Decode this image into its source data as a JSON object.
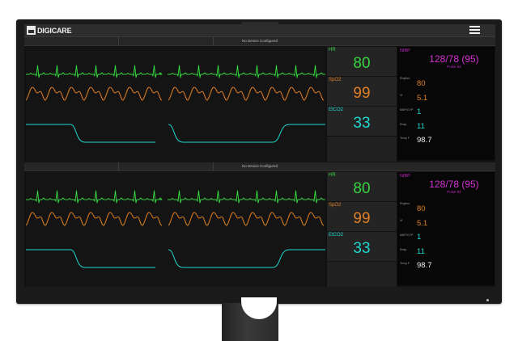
{
  "app": {
    "logo_text": "DIGICARE"
  },
  "colors": {
    "hr": "#36d43f",
    "spo2": "#e07f25",
    "etco2": "#1fd9d0",
    "nibp": "#d632d6",
    "temp": "#eeeeee"
  },
  "panels": [
    {
      "status": "No Device Configured",
      "hr": {
        "label": "HR",
        "value": "80"
      },
      "spo2": {
        "label": "SpO2",
        "value": "99"
      },
      "etco2": {
        "label": "EtCO2",
        "value": "33"
      },
      "nibp": {
        "label": "NIBP",
        "value": "128/78 (95)",
        "pulse": "Pulse 82"
      },
      "params": [
        {
          "label": "Rhythm",
          "value": "80"
        },
        {
          "label": "Vt",
          "value": "5.1"
        },
        {
          "label": "MAP/CVP",
          "value": "1"
        },
        {
          "label": "Resp",
          "value": "11"
        },
        {
          "label": "Temp F",
          "value": "98.7"
        }
      ]
    },
    {
      "status": "No Device Configured",
      "hr": {
        "label": "HR",
        "value": "80"
      },
      "spo2": {
        "label": "SpO2",
        "value": "99"
      },
      "etco2": {
        "label": "EtCO2",
        "value": "33"
      },
      "nibp": {
        "label": "NIBP",
        "value": "128/78 (95)",
        "pulse": "Pulse 82"
      },
      "params": [
        {
          "label": "Rhythm",
          "value": "80"
        },
        {
          "label": "Vt",
          "value": "5.1"
        },
        {
          "label": "MAP/CVP",
          "value": "1"
        },
        {
          "label": "Resp",
          "value": "11"
        },
        {
          "label": "Temp F",
          "value": "98.7"
        }
      ]
    }
  ]
}
